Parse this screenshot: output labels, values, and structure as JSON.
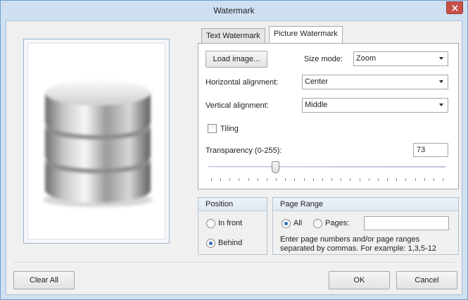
{
  "window": {
    "title": "Watermark"
  },
  "tabs": [
    {
      "label": "Text Watermark",
      "active": false
    },
    {
      "label": "Picture Watermark",
      "active": true
    }
  ],
  "picture_tab": {
    "load_image_label": "Load image...",
    "size_mode_label": "Size mode:",
    "size_mode_value": "Zoom",
    "horizontal_alignment_label": "Horizontal alignment:",
    "horizontal_alignment_value": "Center",
    "vertical_alignment_label": "Vertical alignment:",
    "vertical_alignment_value": "Middle",
    "tiling_label": "Tiling",
    "tiling_checked": false,
    "transparency_label": "Transparency (0-255):",
    "transparency_value": "73",
    "transparency_max": 255
  },
  "position": {
    "header": "Position",
    "in_front_label": "In front",
    "behind_label": "Behind",
    "selected": "Behind"
  },
  "page_range": {
    "header": "Page Range",
    "all_label": "All",
    "pages_label": "Pages:",
    "pages_value": "",
    "selected": "All",
    "hint": "Enter page numbers and/or page ranges separated by commas. For example: 1,3,5-12"
  },
  "footer": {
    "clear_all_label": "Clear All",
    "ok_label": "OK",
    "cancel_label": "Cancel"
  },
  "preview": {
    "icon": "database-icon"
  },
  "colors": {
    "frame": "#cfe0f3",
    "close_button": "#c7504b",
    "radio_dot": "#2f6fc0"
  }
}
